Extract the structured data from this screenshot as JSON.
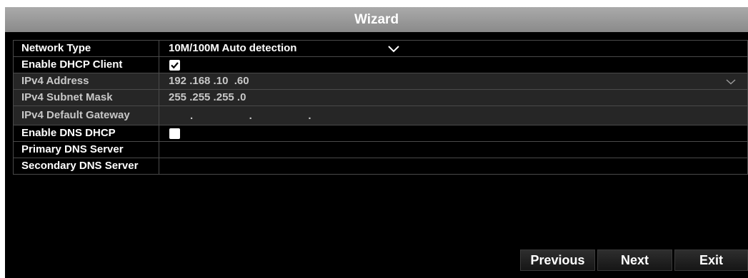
{
  "window": {
    "title": "Wizard"
  },
  "network": {
    "rows": [
      {
        "label": "Network Type",
        "value": "10M/100M Auto detection"
      },
      {
        "label": "Enable DHCP Client",
        "checked": true
      },
      {
        "label": "IPv4 Address",
        "value": "192 .168 .10  .60"
      },
      {
        "label": "IPv4 Subnet Mask",
        "value": "255 .255 .255 .0"
      },
      {
        "label": "IPv4 Default Gateway",
        "value": ".   .   ."
      },
      {
        "label": "Enable DNS DHCP",
        "checked": false
      },
      {
        "label": "Primary DNS Server",
        "value": ""
      },
      {
        "label": "Secondary DNS Server",
        "value": ""
      }
    ]
  },
  "buttons": {
    "previous": "Previous",
    "next": "Next",
    "exit": "Exit"
  },
  "colors": {
    "background": "#000000",
    "title_bar": "#9a9a9a",
    "disabled_row": "#262626",
    "text": "#ffffff",
    "disabled_text": "#c8c8c8"
  },
  "icons": {
    "dropdown": "chevron-down-icon",
    "checkbox": "checkbox-icon"
  }
}
